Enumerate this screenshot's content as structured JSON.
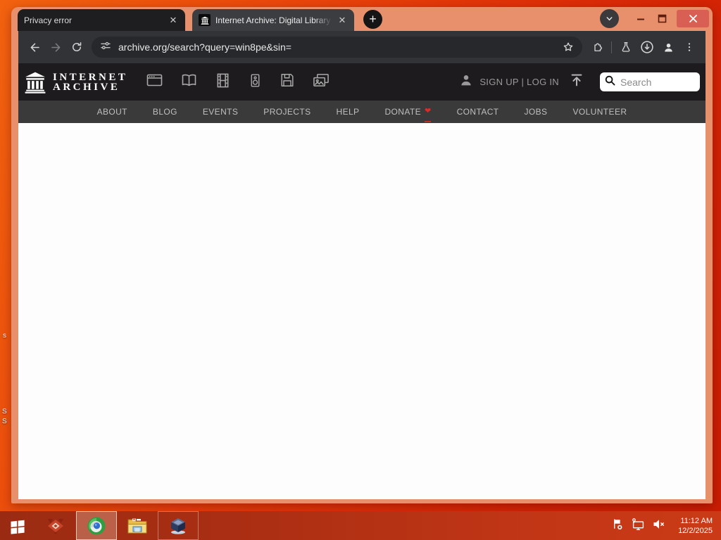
{
  "browser": {
    "tabs": [
      {
        "title": "Privacy error"
      },
      {
        "title": "Internet Archive: Digital Library"
      }
    ],
    "url": "archive.org/search?query=win8pe&sin="
  },
  "ia_header": {
    "logo_line1": "INTERNET",
    "logo_line2": "ARCHIVE",
    "signup_login": "SIGN UP | LOG IN",
    "search_placeholder": "Search"
  },
  "nav": {
    "items": [
      "ABOUT",
      "BLOG",
      "EVENTS",
      "PROJECTS",
      "HELP",
      "DONATE",
      "CONTACT",
      "JOBS",
      "VOLUNTEER"
    ]
  },
  "desktop": {
    "icon_label_fragments": [
      "s",
      "S",
      "S"
    ]
  },
  "taskbar": {
    "time": "11:12 AM",
    "date": "12/2/2025"
  },
  "colors": {
    "titlebar_salmon": "#e8906c",
    "desktop_orange": "#e8440b",
    "taskbar_red": "#b23114",
    "close_button_red": "#d95f55",
    "heart_red": "#e02a2a"
  }
}
